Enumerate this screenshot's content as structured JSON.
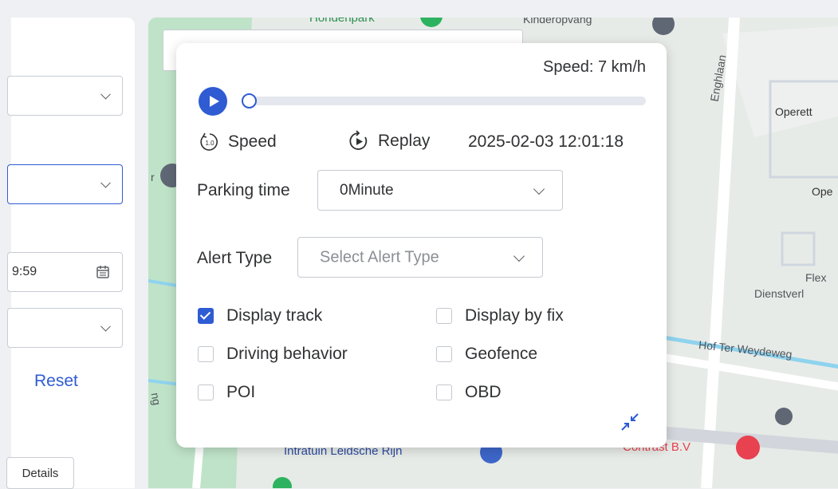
{
  "left_panel": {
    "date_value": "9:59",
    "reset_label": "Reset",
    "details_label": "Details"
  },
  "map": {
    "labels": {
      "hondenpark": "Hondenpark",
      "kinderopvang": "Kinderopvang",
      "enghlaan": "Enghlaan",
      "operette1": "Operett",
      "operette2": "Ope",
      "flex": "Flex",
      "dienstver": "Dienstverl",
      "hof": "Hof Ter Weydeweg",
      "intratuin": "Intratuin Leidsche Rijn",
      "contrast": "Contrast B.V",
      "road_ng": "ng",
      "road_r": "r"
    }
  },
  "playback": {
    "speed_text": "Speed: 7 km/h",
    "progress": 0.0,
    "speed_label": "Speed",
    "speed_icon_text": "1.0",
    "replay_label": "Replay",
    "datetime": "2025-02-03 12:01:18",
    "parking_label": "Parking time",
    "parking_value": "0Minute",
    "alert_label": "Alert Type",
    "alert_placeholder": "Select Alert Type",
    "checkboxes": {
      "display_track": {
        "label": "Display track",
        "checked": true
      },
      "display_by_fix": {
        "label": "Display by fix",
        "checked": false
      },
      "driving_behavior": {
        "label": "Driving behavior",
        "checked": false
      },
      "geofence": {
        "label": "Geofence",
        "checked": false
      },
      "poi": {
        "label": "POI",
        "checked": false
      },
      "obd": {
        "label": "OBD",
        "checked": false
      }
    }
  },
  "colors": {
    "accent": "#2f5bd3",
    "reset_link": "#2f5bd3",
    "poi_marker": "#e8414f",
    "park": "#a9d8b6"
  }
}
